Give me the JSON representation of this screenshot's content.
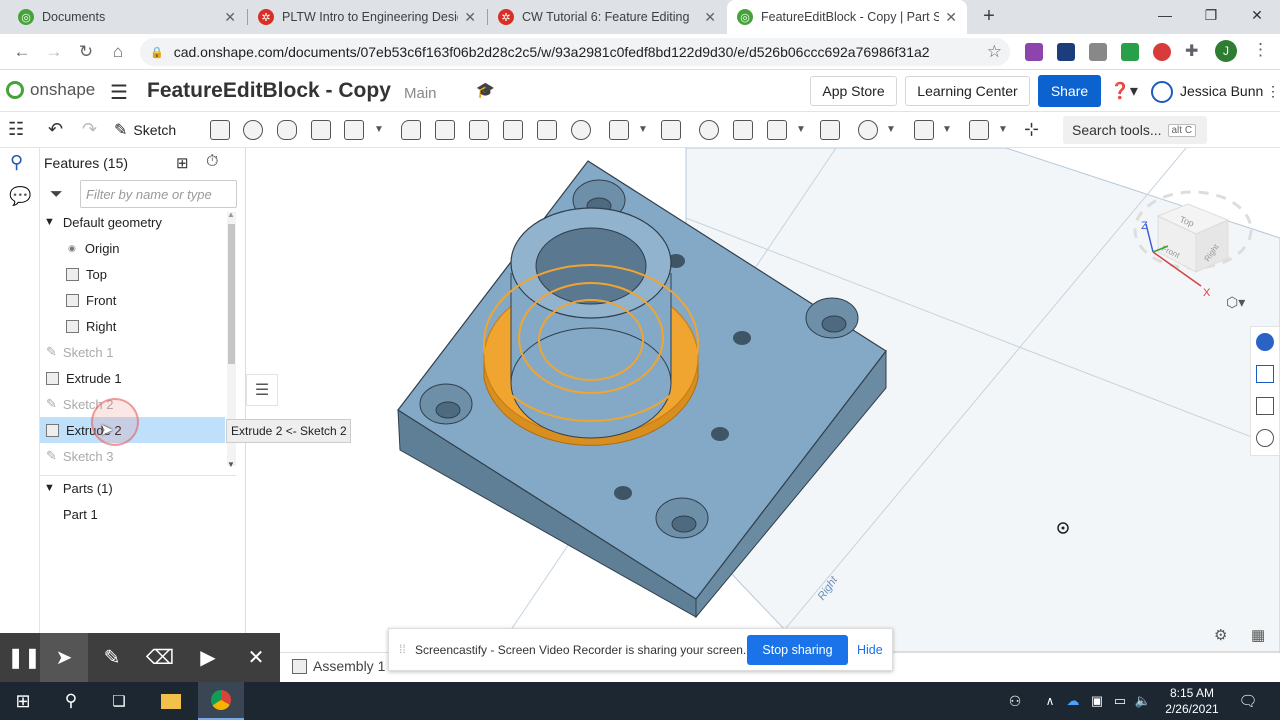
{
  "browser": {
    "tabs": [
      {
        "title": "Documents"
      },
      {
        "title": "PLTW Intro to Engineering Desig"
      },
      {
        "title": "CW Tutorial 6: Feature Editing"
      },
      {
        "title": "FeatureEditBlock - Copy | Part St"
      }
    ],
    "new_tab": "+",
    "url": "cad.onshape.com/documents/07eb53c6f163f06b2d28c2c5/w/93a2981c0fedf8bd122d9d30/e/d526b06ccc692a76986f31a2",
    "profile_initial": "J"
  },
  "header": {
    "logo_text": "onshape",
    "doc_title": "FeatureEditBlock - Copy",
    "branch": "Main",
    "app_store": "App Store",
    "learning_center": "Learning Center",
    "share": "Share",
    "user": "Jessica Bunn"
  },
  "toolbar": {
    "sketch": "Sketch",
    "search_tools": "Search tools...",
    "search_shortcut": "alt C"
  },
  "features": {
    "header": "Features (15)",
    "filter_placeholder": "Filter by name or type",
    "default_geometry": "Default geometry",
    "items": [
      "Origin",
      "Top",
      "Front",
      "Right",
      "Sketch 1",
      "Extrude 1",
      "Sketch 2",
      "Extrude 2",
      "Sketch 3"
    ],
    "parts_header": "Parts (1)",
    "parts": [
      "Part 1"
    ],
    "tooltip": "Extrude 2 <- Sketch 2"
  },
  "viewport": {
    "cube_labels": {
      "top": "Top",
      "front": "Front",
      "right": "Right"
    },
    "axis_z": "Z",
    "axis_x": "X",
    "plane_label": "Right"
  },
  "bottom": {
    "tab": "Assembly 1"
  },
  "screencastify": {
    "message": "Screencastify - Screen Video Recorder is sharing your screen.",
    "stop": "Stop sharing",
    "hide": "Hide"
  },
  "taskbar": {
    "time": "8:15 AM",
    "date": "2/26/2021"
  },
  "colors": {
    "part_blue": "#84a9c7",
    "highlight_orange": "#f0a531",
    "share_blue": "#0c63d0",
    "selected_row": "#bfe0fb"
  }
}
